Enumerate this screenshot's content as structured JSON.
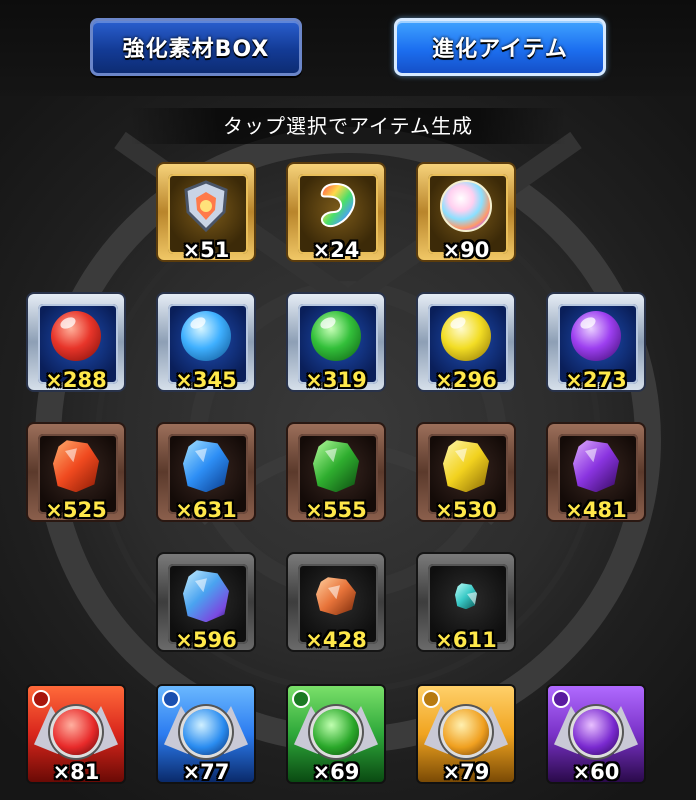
{
  "tabs": [
    {
      "label": "強化素材BOX",
      "active": false
    },
    {
      "label": "進化アイテム",
      "active": true
    }
  ],
  "instruction": "タップ選択でアイテム生成",
  "special_items": [
    {
      "icon": "shield-crest-icon",
      "count": "×51"
    },
    {
      "icon": "rainbow-drop-icon",
      "count": "×24"
    },
    {
      "icon": "rainbow-orb-icon",
      "count": "×90"
    }
  ],
  "orbs": [
    {
      "element": "fire",
      "color": "#e8352a",
      "count": "×288"
    },
    {
      "element": "water",
      "color": "#3fb0ff",
      "count": "×345"
    },
    {
      "element": "wood",
      "color": "#33c03a",
      "count": "×319"
    },
    {
      "element": "light",
      "color": "#f2dd24",
      "count": "×296"
    },
    {
      "element": "dark",
      "color": "#9d3ff0",
      "count": "×273"
    }
  ],
  "stones": [
    {
      "element": "fire",
      "color": "#f04a1f",
      "count": "×525"
    },
    {
      "element": "water",
      "color": "#2d8ef5",
      "count": "×631"
    },
    {
      "element": "wood",
      "color": "#2fae2f",
      "count": "×555"
    },
    {
      "element": "light",
      "color": "#f2d21f",
      "count": "×530"
    },
    {
      "element": "dark",
      "color": "#8a34e0",
      "count": "×481"
    }
  ],
  "gems": [
    {
      "kind": "blue-purple crystal",
      "color": "#4aa3f0",
      "count": "×596"
    },
    {
      "kind": "orange ore",
      "color": "#e8743a",
      "count": "×428"
    },
    {
      "kind": "small cyan gem",
      "color": "#39c9c6",
      "count": "×611"
    }
  ],
  "creatures": [
    {
      "element": "fire",
      "frame": "#d9261c",
      "count": "×81"
    },
    {
      "element": "water",
      "frame": "#2c7cf0",
      "count": "×77"
    },
    {
      "element": "wood",
      "frame": "#2ea83a",
      "count": "×69"
    },
    {
      "element": "light",
      "frame": "#f0a420",
      "count": "×79"
    },
    {
      "element": "dark",
      "frame": "#7a32c8",
      "count": "×60"
    }
  ]
}
